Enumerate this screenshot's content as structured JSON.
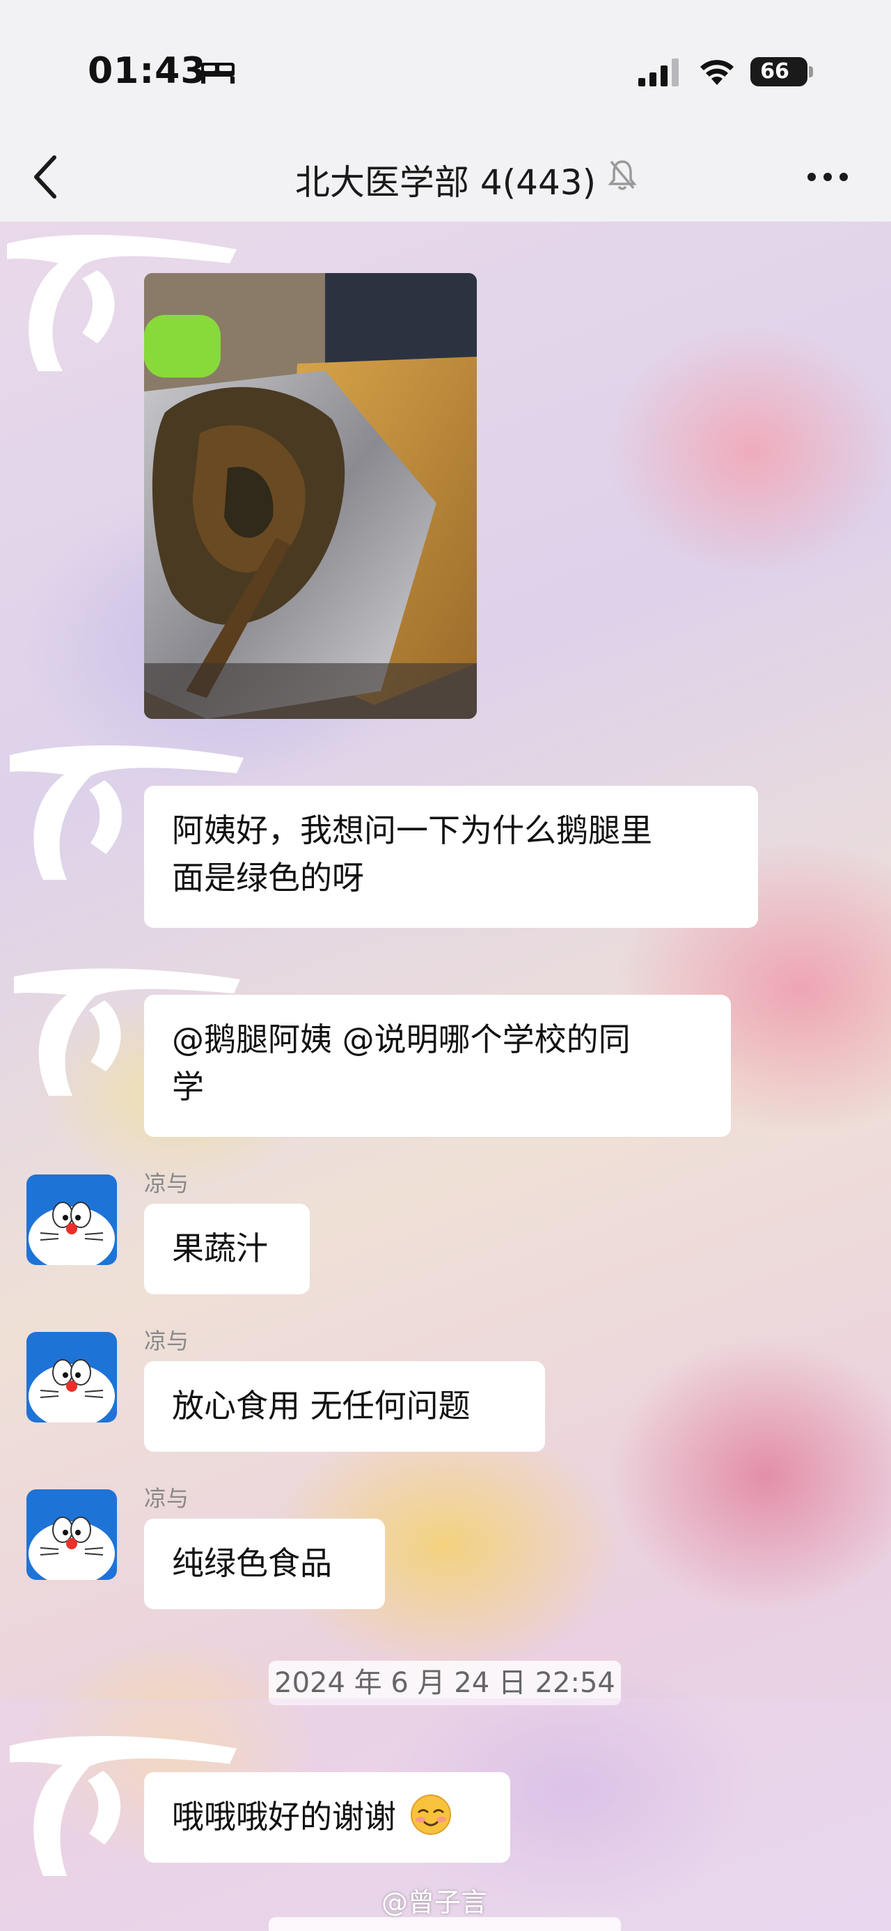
{
  "status_bar": {
    "time": "01:43",
    "battery": "66",
    "sleep_icon": "bed-icon",
    "signal_icon": "cellular-signal-icon",
    "wifi_icon": "wifi-icon"
  },
  "nav": {
    "title": "北大医学部 4(443)",
    "back_icon": "chevron-left-icon",
    "mute_icon": "bell-muted-icon",
    "more_icon": "more-dots-icon"
  },
  "messages": [
    {
      "type": "image",
      "description_icon": "photo"
    },
    {
      "type": "text",
      "text_line1": "阿姨好，我想问一下为什么鹅腿里",
      "text_line2": "面是绿色的呀"
    },
    {
      "type": "text",
      "text_line1": "@鹅腿阿姨 @说明哪个学校的同",
      "text_line2": "学"
    },
    {
      "type": "text",
      "sender": "凉与",
      "text": "果蔬汁"
    },
    {
      "type": "text",
      "sender": "凉与",
      "text": "放心食用 无任何问题"
    },
    {
      "type": "text",
      "sender": "凉与",
      "text": "纯绿色食品"
    },
    {
      "type": "text",
      "text": "哦哦哦好的谢谢"
    }
  ],
  "timestamp": "2024 年 6 月 24 日  22:54",
  "watermark": "@曾子言",
  "colors": {
    "background": "#f2f2f4",
    "bubble": "#ffffff",
    "sender_label": "#888888",
    "avatar_blue": "#1e73d6"
  }
}
